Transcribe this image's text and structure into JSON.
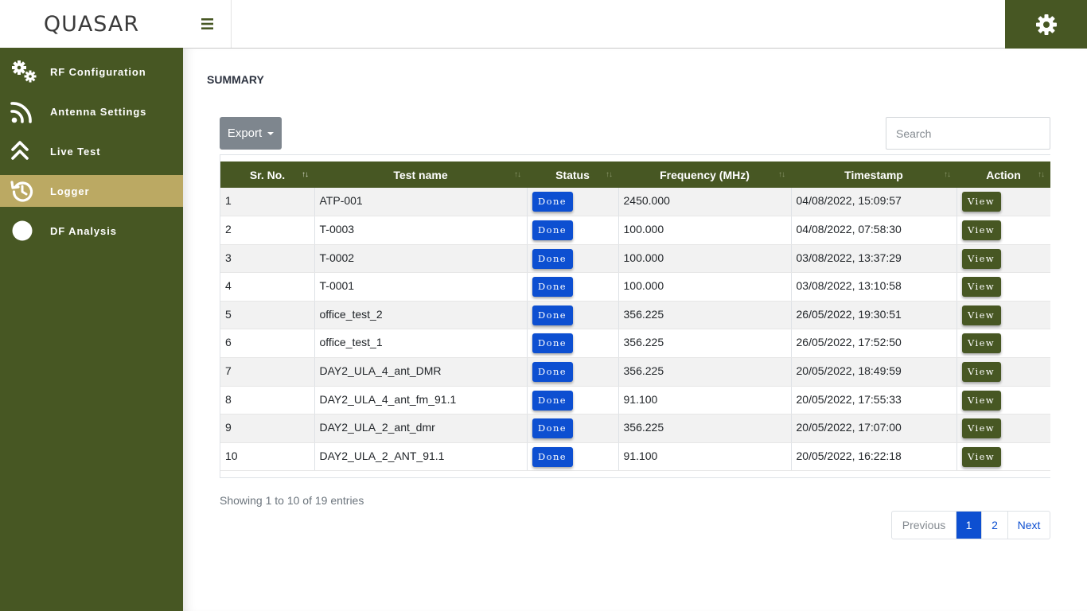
{
  "app": {
    "logo_text": "QUASAR"
  },
  "sidebar": {
    "items": [
      {
        "label": "RF Configuration",
        "icon": "gears-icon"
      },
      {
        "label": "Antenna Settings",
        "icon": "rss-icon"
      },
      {
        "label": "Live Test",
        "icon": "double-chevron-up-icon"
      },
      {
        "label": "Logger",
        "icon": "history-icon",
        "active": true
      },
      {
        "label": "DF Analysis",
        "icon": "circle-icon"
      }
    ]
  },
  "page": {
    "title": "SUMMARY"
  },
  "toolbar": {
    "export_label": "Export",
    "search_placeholder": "Search"
  },
  "table": {
    "columns": [
      "Sr. No.",
      "Test name",
      "Status",
      "Frequency (MHz)",
      "Timestamp",
      "Action"
    ],
    "rows": [
      {
        "sr": "1",
        "name": "ATP-001",
        "status": "Done",
        "freq": "2450.000",
        "ts": "04/08/2022, 15:09:57",
        "action": "View"
      },
      {
        "sr": "2",
        "name": "T-0003",
        "status": "Done",
        "freq": "100.000",
        "ts": "04/08/2022, 07:58:30",
        "action": "View"
      },
      {
        "sr": "3",
        "name": "T-0002",
        "status": "Done",
        "freq": "100.000",
        "ts": "03/08/2022, 13:37:29",
        "action": "View"
      },
      {
        "sr": "4",
        "name": "T-0001",
        "status": "Done",
        "freq": "100.000",
        "ts": "03/08/2022, 13:10:58",
        "action": "View"
      },
      {
        "sr": "5",
        "name": "office_test_2",
        "status": "Done",
        "freq": "356.225",
        "ts": "26/05/2022, 19:30:51",
        "action": "View"
      },
      {
        "sr": "6",
        "name": "office_test_1",
        "status": "Done",
        "freq": "356.225",
        "ts": "26/05/2022, 17:52:50",
        "action": "View"
      },
      {
        "sr": "7",
        "name": "DAY2_ULA_4_ant_DMR",
        "status": "Done",
        "freq": "356.225",
        "ts": "20/05/2022, 18:49:59",
        "action": "View"
      },
      {
        "sr": "8",
        "name": "DAY2_ULA_4_ant_fm_91.1",
        "status": "Done",
        "freq": "91.100",
        "ts": "20/05/2022, 17:55:33",
        "action": "View"
      },
      {
        "sr": "9",
        "name": "DAY2_ULA_2_ant_dmr",
        "status": "Done",
        "freq": "356.225",
        "ts": "20/05/2022, 17:07:00",
        "action": "View"
      },
      {
        "sr": "10",
        "name": "DAY2_ULA_2_ANT_91.1",
        "status": "Done",
        "freq": "91.100",
        "ts": "20/05/2022, 16:22:18",
        "action": "View"
      }
    ]
  },
  "footer": {
    "info": "Showing 1 to 10 of 19 entries",
    "pagination": {
      "prev": "Previous",
      "pages": [
        "1",
        "2"
      ],
      "current": "1",
      "next": "Next"
    }
  },
  "colors": {
    "brand": "#475723",
    "active_nav": "#bba963",
    "badge_blue": "#0d4fd1",
    "export_gray": "#7e868e"
  }
}
